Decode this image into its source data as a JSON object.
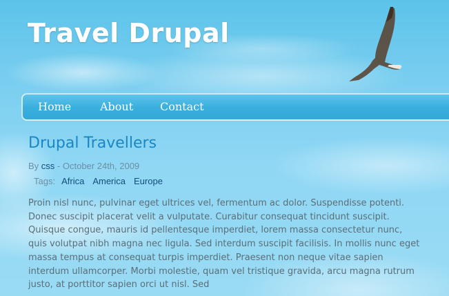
{
  "site": {
    "title": "Travel Drupal"
  },
  "nav": {
    "items": [
      {
        "label": "Home"
      },
      {
        "label": "About"
      },
      {
        "label": "Contact"
      }
    ]
  },
  "post": {
    "title": "Drupal Travellers",
    "by_label": "By",
    "author": "css",
    "date_text": "- October 24th, 2009",
    "tags_label": "Tags:",
    "tags": [
      "Africa",
      "America",
      "Europe"
    ],
    "body": "Proin nisl nunc, pulvinar eget ultrices vel, fermentum ac dolor. Suspendisse potenti. Donec suscipit placerat velit a vulputate. Curabitur consequat tincidunt suscipit. Quisque congue, mauris id pellentesque imperdiet, lorem massa consectetur nunc, quis volutpat nibh magna nec ligula. Sed interdum suscipit facilisis. In mollis nunc eget massa tempus at consequat turpis imperdiet. Praesent non neque vitae sapien interdum ullamcorper. Morbi molestie, quam vel tristique gravida, arcu magna rutrum justo, at porttitor sapien orci ut nisl. Sed"
  },
  "colors": {
    "sky": "#7ccff0",
    "nav_bar": "#3bb0de",
    "post_title": "#1a86c4",
    "link": "#144c7a",
    "body_text": "#5b6e78"
  },
  "icons": {
    "header_image": "eagle-icon"
  }
}
